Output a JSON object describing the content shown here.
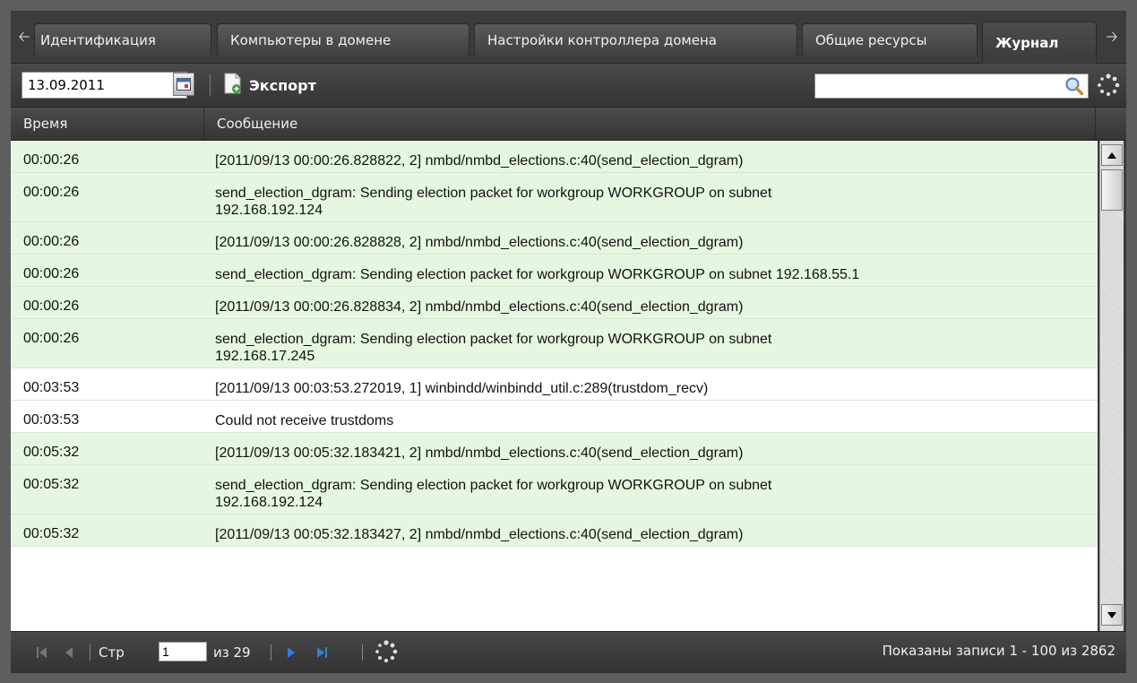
{
  "tabs": {
    "items": [
      {
        "label": "Идентификация"
      },
      {
        "label": "Компьютеры в домене"
      },
      {
        "label": "Настройки контроллера домена"
      },
      {
        "label": "Общие ресурсы"
      },
      {
        "label": "Журнал"
      }
    ],
    "active_index": 4,
    "scroll_left_icon": "arrow-left-icon",
    "scroll_right_icon": "arrow-right-icon"
  },
  "toolbar": {
    "date_value": "13.09.2011",
    "calendar_icon": "calendar-icon",
    "export_label": "Экспорт",
    "export_icon": "export-document-icon",
    "search_value": "",
    "search_icon": "magnifier-icon",
    "refresh_icon": "loading-spinner-icon"
  },
  "grid": {
    "columns": [
      "Время",
      "Сообщение"
    ],
    "rows": [
      {
        "time": "00:00:26",
        "message": [
          "[2011/09/13 00:00:26.828822, 2] nmbd/nmbd_elections.c:40(send_election_dgram)"
        ],
        "tone": "green"
      },
      {
        "time": "00:00:26",
        "message": [
          "send_election_dgram: Sending election packet for workgroup WORKGROUP on subnet",
          "192.168.192.124"
        ],
        "tone": "green"
      },
      {
        "time": "00:00:26",
        "message": [
          "[2011/09/13 00:00:26.828828, 2] nmbd/nmbd_elections.c:40(send_election_dgram)"
        ],
        "tone": "green"
      },
      {
        "time": "00:00:26",
        "message": [
          "send_election_dgram: Sending election packet for workgroup WORKGROUP on subnet 192.168.55.1"
        ],
        "tone": "green"
      },
      {
        "time": "00:00:26",
        "message": [
          "[2011/09/13 00:00:26.828834, 2] nmbd/nmbd_elections.c:40(send_election_dgram)"
        ],
        "tone": "green"
      },
      {
        "time": "00:00:26",
        "message": [
          "send_election_dgram: Sending election packet for workgroup WORKGROUP on subnet",
          "192.168.17.245"
        ],
        "tone": "green"
      },
      {
        "time": "00:03:53",
        "message": [
          "[2011/09/13 00:03:53.272019, 1] winbindd/winbindd_util.c:289(trustdom_recv)"
        ],
        "tone": "white"
      },
      {
        "time": "00:03:53",
        "message": [
          "Could not receive trustdoms"
        ],
        "tone": "white"
      },
      {
        "time": "00:05:32",
        "message": [
          "[2011/09/13 00:05:32.183421, 2] nmbd/nmbd_elections.c:40(send_election_dgram)"
        ],
        "tone": "green"
      },
      {
        "time": "00:05:32",
        "message": [
          "send_election_dgram: Sending election packet for workgroup WORKGROUP on subnet",
          "192.168.192.124"
        ],
        "tone": "green"
      },
      {
        "time": "00:05:32",
        "message": [
          "[2011/09/13 00:05:32.183427, 2] nmbd/nmbd_elections.c:40(send_election_dgram)"
        ],
        "tone": "green"
      }
    ],
    "colors": {
      "green_row": "#e6f7e1",
      "white_row": "#ffffff"
    }
  },
  "pager": {
    "page_label": "Стр",
    "page_value": "1",
    "of_label": "из 29",
    "info": "Показаны записи 1 - 100 из 2862",
    "first_icon": "first-page-icon",
    "prev_icon": "prev-page-icon",
    "next_icon": "next-page-icon",
    "last_icon": "last-page-icon",
    "refresh_icon": "refresh-icon"
  }
}
